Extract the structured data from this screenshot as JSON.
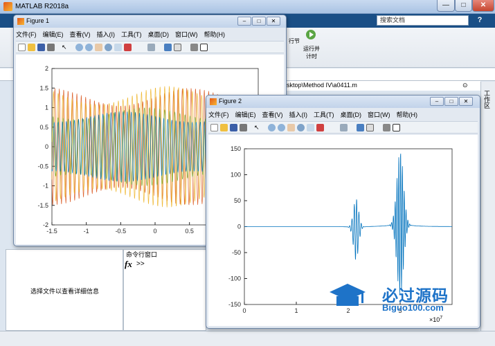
{
  "app": {
    "title": "MATLAB R2018a"
  },
  "window_buttons": {
    "minimize": "—",
    "maximize": "□",
    "close": "✕"
  },
  "search": {
    "placeholder": "搜索文档"
  },
  "ribbon": {
    "run_section": "行节",
    "run_time_label_1": "运行并",
    "run_time_label_2": "计时"
  },
  "address": {
    "path": "sktop\\Method IV\\a0411.m"
  },
  "workspace_label": "工作区",
  "detail": {
    "message": "选择文件以查看详细信息"
  },
  "command": {
    "title": "命令行窗口",
    "fx": "fx",
    "prompt": ">>"
  },
  "menu_items": [
    "文件(F)",
    "编辑(E)",
    "查看(V)",
    "插入(I)",
    "工具(T)",
    "桌面(D)",
    "窗口(W)",
    "帮助(H)"
  ],
  "figure1": {
    "title": "Figure 1"
  },
  "figure2": {
    "title": "Figure 2",
    "exponent": "×10",
    "exponent_power": "7"
  },
  "watermark": {
    "line1": "必过源码",
    "line2": "Biguo100.com"
  },
  "chart_data": [
    {
      "type": "line",
      "xlim": [
        -1.5,
        1.5
      ],
      "ylim": [
        -2,
        2
      ],
      "xticks": [
        "-1.5",
        "-1",
        "-0.5",
        "0",
        "0.5"
      ],
      "yticks": [
        "2",
        "1.5",
        "1",
        "0.5",
        "0",
        "-0.5",
        "-1",
        "-1.5",
        "-2"
      ],
      "series": [
        {
          "color": "#d95319",
          "amplitude": 1.5
        },
        {
          "color": "#edb120",
          "amplitude": 1.55
        },
        {
          "color": "#77ac30",
          "amplitude": 1.0
        },
        {
          "color": "#0072bd",
          "amplitude": 0.9
        }
      ]
    },
    {
      "type": "line",
      "xlim": [
        0,
        4
      ],
      "ylim": [
        -150,
        150
      ],
      "xticks": [
        "0",
        "1",
        "2",
        "3"
      ],
      "yticks": [
        "150",
        "100",
        "50",
        "0",
        "-50",
        "-100",
        "-150"
      ],
      "series": [
        {
          "color": "#0072bd"
        }
      ]
    }
  ]
}
